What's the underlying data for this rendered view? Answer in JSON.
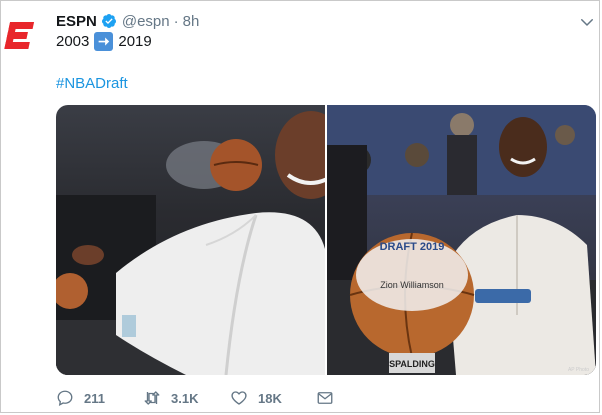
{
  "tweet": {
    "author_name": "ESPN",
    "author_handle": "@espn",
    "separator": "·",
    "time": "8h",
    "text_before": "2003",
    "text_after": "2019",
    "hashtag": "#NBADraft",
    "verified": true
  },
  "media": {
    "left_photo_alt": "",
    "right_ball_text_top": "DRAFT 2019",
    "right_ball_name": "Zion Williamson",
    "right_ball_brand": "SPALDING",
    "photo_credit": "AP Photo"
  },
  "actions": {
    "replies": "211",
    "retweets": "3.1K",
    "likes": "18K"
  },
  "colors": {
    "brand_red": "#e8262b",
    "link_blue": "#1b95e0",
    "muted_gray": "#657786",
    "verified_blue": "#1da1f2"
  },
  "icons": [
    "espn-logo-icon",
    "verified-badge-icon",
    "caret-down-icon",
    "arrow-right-emoji-icon",
    "reply-icon",
    "retweet-icon",
    "like-icon",
    "share-message-icon"
  ]
}
